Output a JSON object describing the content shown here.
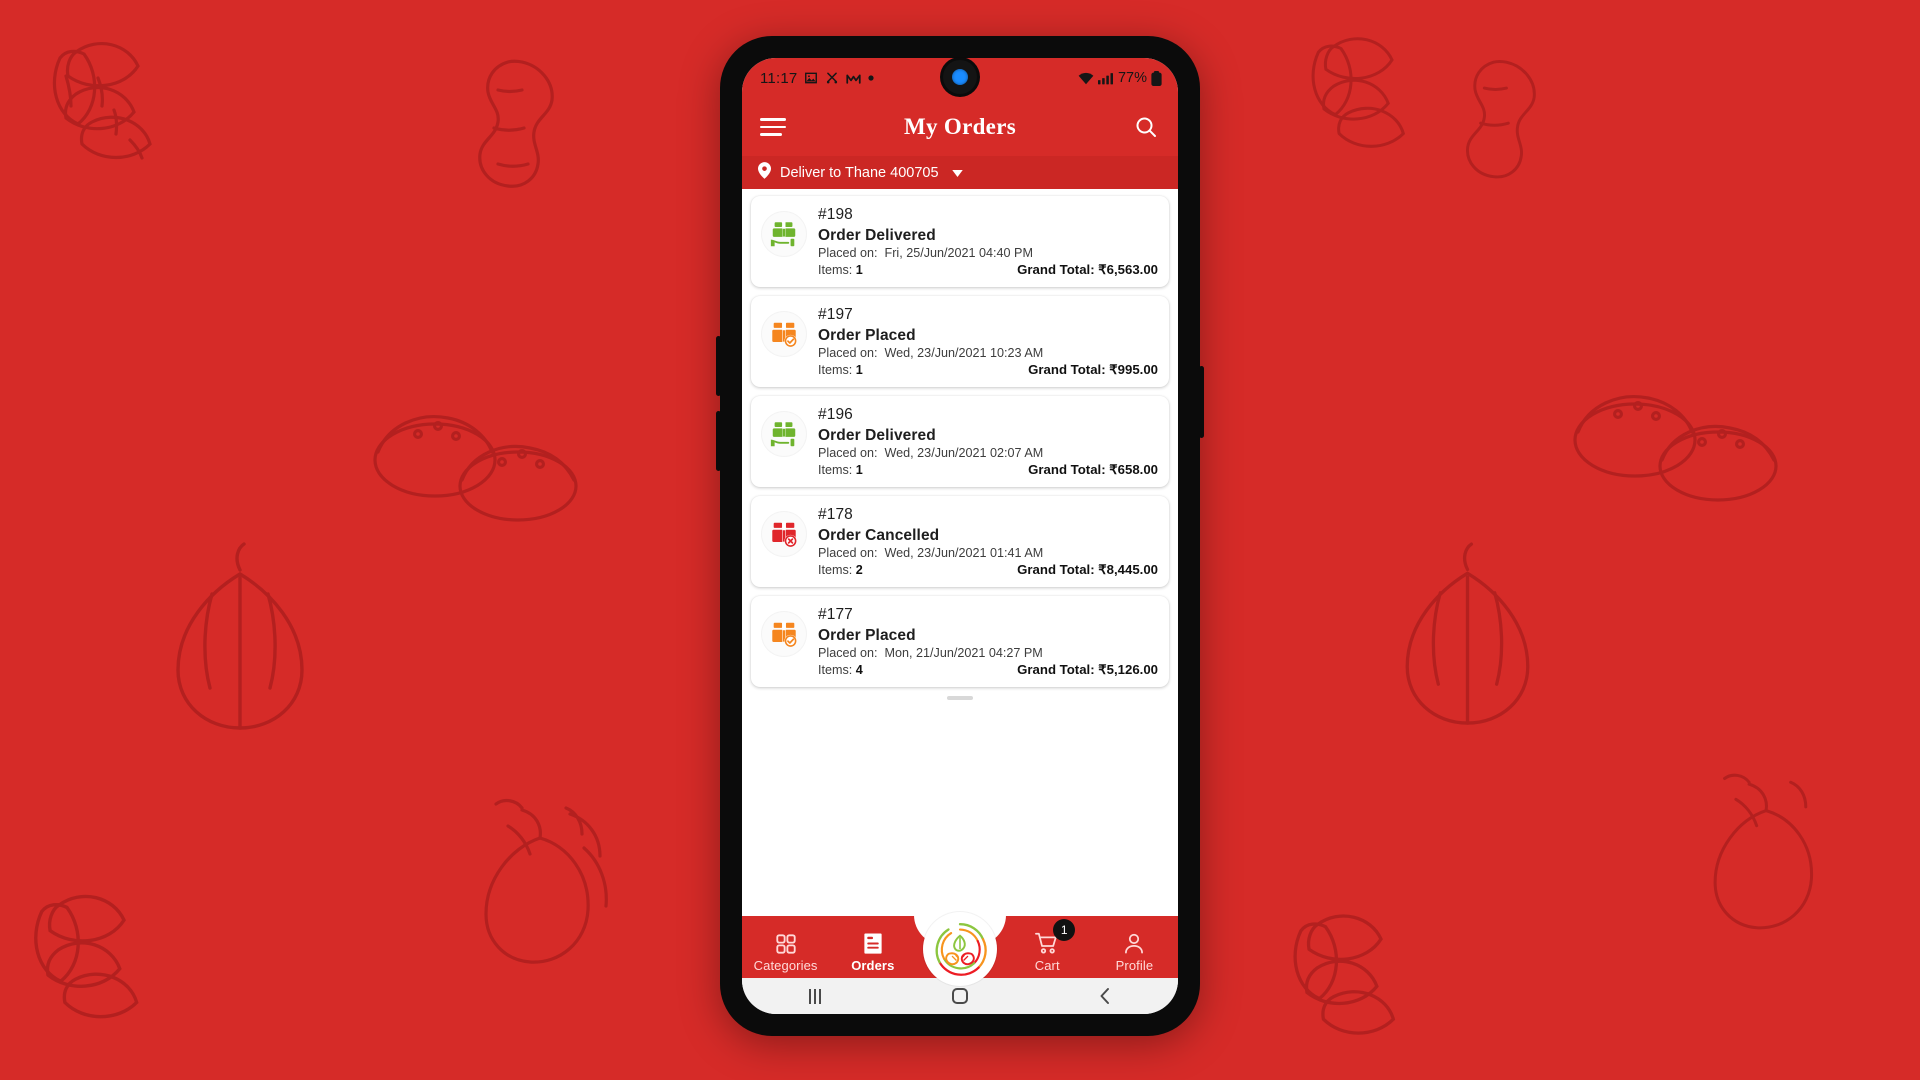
{
  "background": {
    "color": "#d62b28",
    "pattern_name": "spice-illustrations-outline",
    "motifs": [
      "almonds",
      "ginger-root",
      "cardamom-pods",
      "garlic-bulb",
      "red-chilli",
      "spice-powder-bowls"
    ]
  },
  "phone": {
    "status_bar": {
      "time": "11:17",
      "left_icons": [
        "image-icon",
        "scissors-icon",
        "messenger-m-icon",
        "dot-icon"
      ],
      "right_icons": [
        "wifi-icon",
        "signal-icon",
        "battery-icon"
      ],
      "battery_percent": "77%"
    },
    "app_bar": {
      "menu_icon": "hamburger-menu-icon",
      "title": "My Orders",
      "search_icon": "search-icon"
    },
    "deliver_bar": {
      "pin_icon": "location-pin-icon",
      "text": "Deliver to Thane 400705",
      "caret_icon": "chevron-down-icon"
    },
    "orders": [
      {
        "id": "#198",
        "status": "Order Delivered",
        "status_type": "delivered",
        "icon": "package-in-hand-icon",
        "icon_color": "#6fb42e",
        "placed_label": "Placed on:",
        "placed_on": "Fri, 25/Jun/2021 04:40 PM",
        "items_label": "Items:",
        "items": "1",
        "total_label": "Grand Total:",
        "total": "₹6,563.00"
      },
      {
        "id": "#197",
        "status": "Order Placed",
        "status_type": "placed",
        "icon": "package-check-icon",
        "icon_color": "#f5861f",
        "placed_label": "Placed on:",
        "placed_on": "Wed, 23/Jun/2021 10:23 AM",
        "items_label": "Items:",
        "items": "1",
        "total_label": "Grand Total:",
        "total": "₹995.00"
      },
      {
        "id": "#196",
        "status": "Order Delivered",
        "status_type": "delivered",
        "icon": "package-in-hand-icon",
        "icon_color": "#6fb42e",
        "placed_label": "Placed on:",
        "placed_on": "Wed, 23/Jun/2021 02:07 AM",
        "items_label": "Items:",
        "items": "1",
        "total_label": "Grand Total:",
        "total": "₹658.00"
      },
      {
        "id": "#178",
        "status": "Order Cancelled",
        "status_type": "cancelled",
        "icon": "package-cancel-icon",
        "icon_color": "#e0262b",
        "placed_label": "Placed on:",
        "placed_on": "Wed, 23/Jun/2021 01:41 AM",
        "items_label": "Items:",
        "items": "2",
        "total_label": "Grand Total:",
        "total": "₹8,445.00"
      },
      {
        "id": "#177",
        "status": "Order Placed",
        "status_type": "placed",
        "icon": "package-check-icon",
        "icon_color": "#f5861f",
        "placed_label": "Placed on:",
        "placed_on": "Mon, 21/Jun/2021 04:27 PM",
        "items_label": "Items:",
        "items": "4",
        "total_label": "Grand Total:",
        "total": "₹5,126.00"
      }
    ],
    "bottom_nav": {
      "items": [
        {
          "label": "Categories",
          "icon": "grid-icon",
          "active": false
        },
        {
          "label": "Orders",
          "icon": "document-lines-icon",
          "active": true
        },
        {
          "label": "Cart",
          "icon": "shopping-cart-icon",
          "active": false,
          "badge": "1"
        },
        {
          "label": "Profile",
          "icon": "person-icon",
          "active": false
        }
      ],
      "logo_name": "app-logo-spiral-leaf"
    },
    "android_nav": {
      "recents_icon": "recents-icon",
      "home_icon": "home-icon",
      "back_icon": "back-icon"
    }
  }
}
